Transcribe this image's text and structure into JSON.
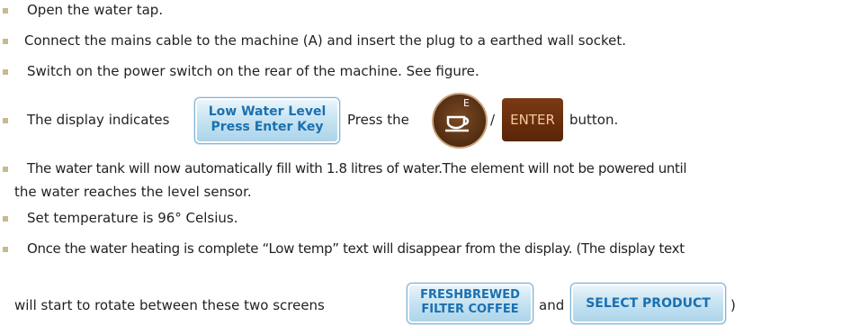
{
  "items": [
    {
      "text": "Open the water tap."
    },
    {
      "text": "Connect the mains cable to the machine (A) and insert the plug to a earthed wall socket."
    },
    {
      "text": "Switch on the power switch on the rear of the machine. See figure."
    },
    {
      "before": "The display indicates",
      "display_line1": "Low Water Level",
      "display_line2": "Press Enter Key",
      "middle": "Press the",
      "coffee_button_letter": "E",
      "separator": "/",
      "enter_label": "ENTER",
      "after": "button."
    },
    {
      "line1": "The water tank will now automatically fill with 1.8 litres of water.The element will not be powered until",
      "line2": "the water reaches the level sensor."
    },
    {
      "text": "Set temperature is 96° Celsius."
    },
    {
      "line1": "Once the water heating is complete “Low temp” text will disappear from the display. (The display text",
      "line2_before": "will start to rotate between these two screens",
      "screen1_line1": "FRESHBREWED",
      "screen1_line2": "FILTER COFFEE",
      "and": "and",
      "screen2": "SELECT PRODUCT",
      "close": ")"
    }
  ],
  "colors": {
    "bullet": "#c9b98e",
    "lcd_text": "#1a70b0",
    "enter_button": "#6b2e0e",
    "coffee_button": "#5b3316"
  },
  "icons": [
    "square-bullet",
    "coffee-cup-icon"
  ]
}
